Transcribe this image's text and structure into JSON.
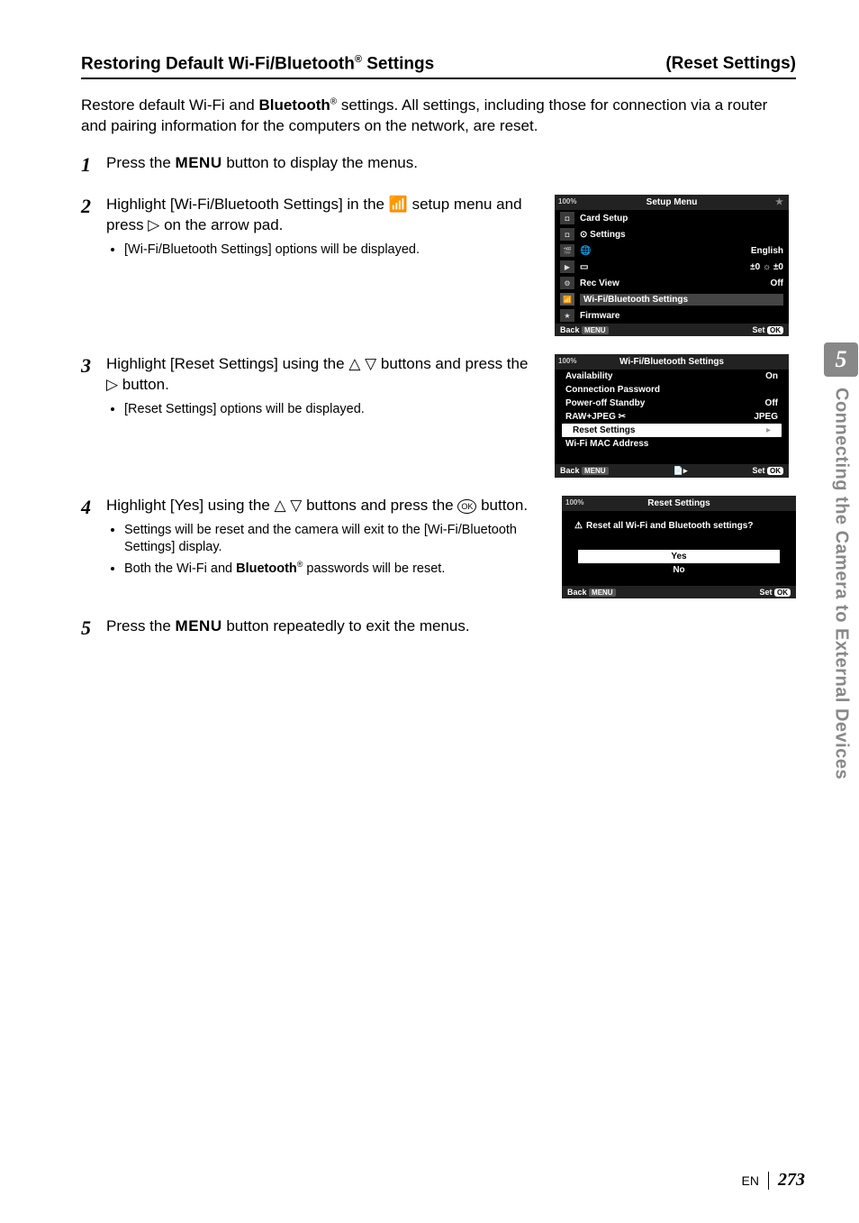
{
  "heading": {
    "left_pre": "Restoring Default Wi-Fi/Bluetooth",
    "left_sup": "®",
    "left_post": " Settings",
    "right": "(Reset Settings)"
  },
  "intro": {
    "p1a": "Restore default Wi-Fi and ",
    "p1b_bold": "Bluetooth",
    "p1b_sup": "®",
    "p1c": " settings. All settings, including those for connection via a router and pairing information for the computers on the network, are reset."
  },
  "steps": {
    "s1": {
      "num": "1",
      "t1": "Press the ",
      "t2_bold": "MENU",
      "t3": " button to display the menus."
    },
    "s2": {
      "num": "2",
      "t1": "Highlight [Wi-Fi/Bluetooth Settings] in the ",
      "t2_glyph": "📶",
      "t3": " setup menu and press ",
      "t4_glyph": "▷",
      "t5": " on the arrow pad.",
      "sub1": "[Wi-Fi/Bluetooth Settings] options will be displayed."
    },
    "s3": {
      "num": "3",
      "t1": "Highlight [Reset Settings] using the ",
      "t2_glyph": "△ ▽",
      "t3": " buttons and press the ",
      "t4_glyph": "▷",
      "t5": " button.",
      "sub1": "[Reset Settings] options will be displayed."
    },
    "s4": {
      "num": "4",
      "t1": "Highlight [Yes] using the ",
      "t2_glyph": "△ ▽",
      "t3": " buttons and press the ",
      "t4_ok": "OK",
      "t5": " button.",
      "sub1": "Settings will be reset and the camera will exit to the [Wi-Fi/Bluetooth Settings] display.",
      "sub2a": "Both the Wi-Fi and ",
      "sub2b_bold": "Bluetooth",
      "sub2b_sup": "®",
      "sub2c": " passwords will be reset."
    },
    "s5": {
      "num": "5",
      "t1": "Press the ",
      "t2_bold": "MENU",
      "t3": " button repeatedly to exit the menus."
    }
  },
  "screen1": {
    "title": "Setup Menu",
    "batt": "100%",
    "items": {
      "r1": "Card Setup",
      "r2": "Settings",
      "r3_val": "English",
      "r4_val": "±0 ☼ ±0",
      "r5": "Rec View",
      "r5_val": "Off",
      "r6": "Wi-Fi/Bluetooth Settings",
      "r7": "Firmware"
    },
    "foot_back": "Back",
    "foot_menu": "MENU",
    "foot_set": "Set",
    "foot_ok": "OK"
  },
  "screen2": {
    "title": "Wi-Fi/Bluetooth Settings",
    "batt": "100%",
    "r1": "Availability",
    "r1v": "On",
    "r2": "Connection Password",
    "r3": "Power-off Standby",
    "r3v": "Off",
    "r4": "RAW+JPEG ",
    "r4v": "JPEG",
    "r5": "Reset Settings",
    "r6": "Wi-Fi MAC Address",
    "foot_back": "Back",
    "foot_menu": "MENU",
    "foot_set": "Set",
    "foot_ok": "OK"
  },
  "screen3": {
    "title": "Reset Settings",
    "batt": "100%",
    "msg": "Reset all Wi-Fi and Bluetooth settings?",
    "yes": "Yes",
    "no": "No",
    "foot_back": "Back",
    "foot_menu": "MENU",
    "foot_set": "Set",
    "foot_ok": "OK"
  },
  "side": {
    "num": "5",
    "text": "Connecting the Camera to External Devices"
  },
  "footer": {
    "lang": "EN",
    "page": "273"
  }
}
